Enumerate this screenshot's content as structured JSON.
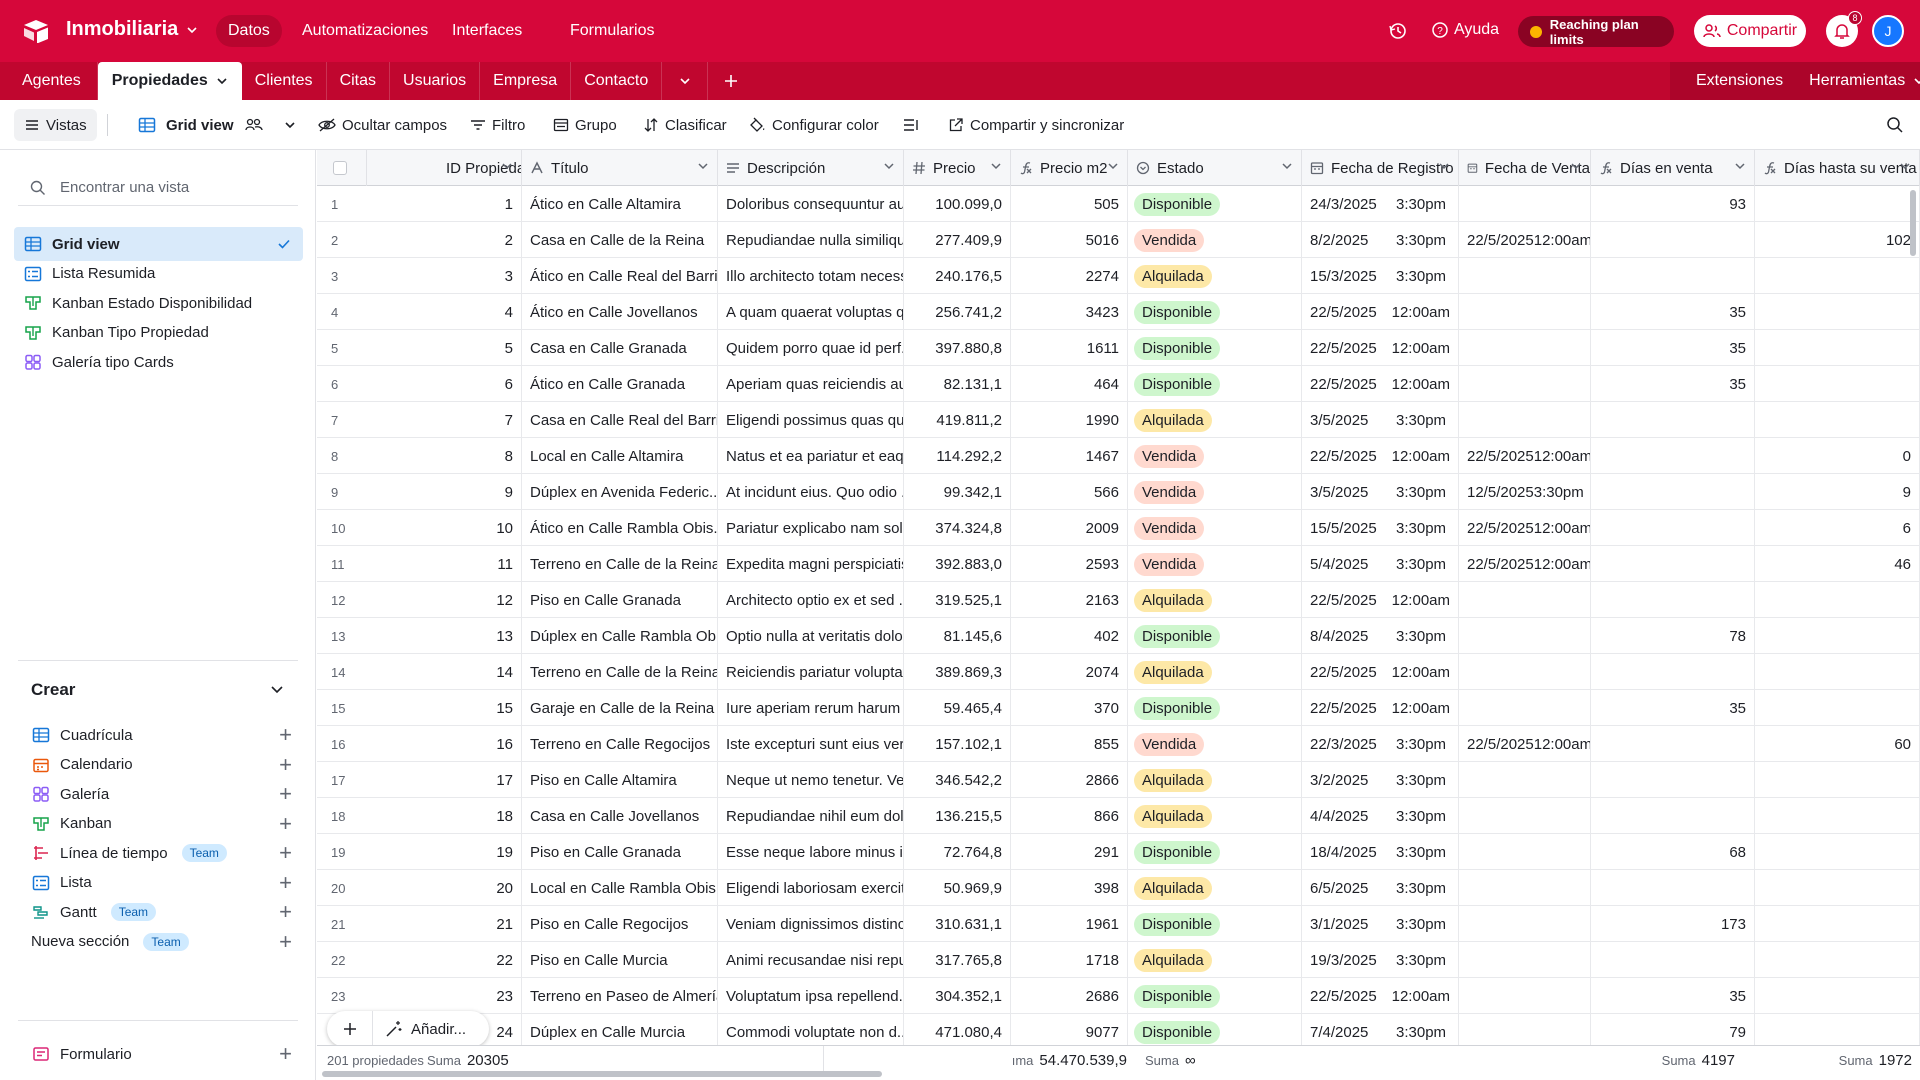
{
  "app": {
    "base_name": "Inmobiliaria",
    "nav": [
      "Datos",
      "Automatizaciones",
      "Interfaces",
      "Formularios"
    ],
    "help": "Ayuda",
    "limits": "Reaching plan limits",
    "share": "Compartir",
    "notifications": "8",
    "avatar": "J"
  },
  "tables": {
    "tabs": [
      "Agentes",
      "Propiedades",
      "Clientes",
      "Citas",
      "Usuarios",
      "Empresa",
      "Contacto"
    ],
    "active": "Propiedades",
    "extensions": "Extensiones",
    "tools": "Herramientas"
  },
  "toolbar": {
    "views": "Vistas",
    "view_name": "Grid view",
    "hide_fields": "Ocultar campos",
    "filter": "Filtro",
    "group": "Grupo",
    "sort": "Clasificar",
    "color": "Configurar color",
    "share_sync": "Compartir y sincronizar"
  },
  "sidebar": {
    "search_placeholder": "Encontrar una vista",
    "views": [
      {
        "label": "Grid view",
        "icon": "grid-icon",
        "color": "#1677d8"
      },
      {
        "label": "Lista Resumida",
        "icon": "list-icon",
        "color": "#1677d8"
      },
      {
        "label": "Kanban Estado Disponibilidad",
        "icon": "kanban-icon",
        "color": "#16a34a"
      },
      {
        "label": "Kanban Tipo Propiedad",
        "icon": "kanban-icon",
        "color": "#16a34a"
      },
      {
        "label": "Galería tipo Cards",
        "icon": "gallery-icon",
        "color": "#8b5cf6"
      }
    ],
    "create_title": "Crear",
    "create": [
      {
        "label": "Cuadrícula",
        "icon": "grid-icon",
        "color": "#1677d8",
        "team": ""
      },
      {
        "label": "Calendario",
        "icon": "calendar-icon",
        "color": "#ea580c",
        "team": ""
      },
      {
        "label": "Galería",
        "icon": "gallery-icon",
        "color": "#8b5cf6",
        "team": ""
      },
      {
        "label": "Kanban",
        "icon": "kanban-icon",
        "color": "#16a34a",
        "team": ""
      },
      {
        "label": "Línea de tiempo",
        "icon": "timeline-icon",
        "color": "#dc2650",
        "team": "Team"
      },
      {
        "label": "Lista",
        "icon": "list-icon",
        "color": "#1677d8",
        "team": ""
      },
      {
        "label": "Gantt",
        "icon": "gantt-icon",
        "color": "#0d9488",
        "team": "Team"
      },
      {
        "label": "Nueva sección",
        "icon": "",
        "color": "",
        "team": "Team"
      }
    ],
    "form": {
      "label": "Formulario",
      "icon": "form-icon",
      "color": "#db2777"
    }
  },
  "columns": [
    "ID Propiedad",
    "Título",
    "Descripción",
    "Precio",
    "Precio m2",
    "Estado",
    "Fecha de Registro",
    "Fecha de Venta",
    "Días en venta",
    "Días hasta su venta"
  ],
  "rows": [
    [
      1,
      "Ático en Calle Altamira",
      "Doloribus consequuntur au...",
      "100.099,0",
      "505",
      "Disponible",
      "24/3/2025",
      "3:30pm",
      "",
      "",
      "93",
      ""
    ],
    [
      2,
      "Casa en Calle de la Reina",
      "Repudiandae nulla similiqu...",
      "277.409,9",
      "5016",
      "Vendida",
      "8/2/2025",
      "3:30pm",
      "22/5/2025",
      "12:00am",
      "",
      "102"
    ],
    [
      3,
      "Ático en Calle Real del Barri...",
      "Illo architecto totam necess...",
      "240.176,5",
      "2274",
      "Alquilada",
      "15/3/2025",
      "3:30pm",
      "",
      "",
      "",
      ""
    ],
    [
      4,
      "Ático en Calle Jovellanos",
      "A quam quaerat voluptas q...",
      "256.741,2",
      "3423",
      "Disponible",
      "22/5/2025",
      "12:00am",
      "",
      "",
      "35",
      ""
    ],
    [
      5,
      "Casa en Calle Granada",
      "Quidem porro quae id perf...",
      "397.880,8",
      "1611",
      "Disponible",
      "22/5/2025",
      "12:00am",
      "",
      "",
      "35",
      ""
    ],
    [
      6,
      "Ático en Calle Granada",
      "Aperiam quas reiciendis au...",
      "82.131,1",
      "464",
      "Disponible",
      "22/5/2025",
      "12:00am",
      "",
      "",
      "35",
      ""
    ],
    [
      7,
      "Casa en Calle Real del Barri...",
      "Eligendi possimus quas qu...",
      "419.811,2",
      "1990",
      "Alquilada",
      "3/5/2025",
      "3:30pm",
      "",
      "",
      "",
      ""
    ],
    [
      8,
      "Local en Calle Altamira",
      "Natus et ea pariatur et eaq...",
      "114.292,2",
      "1467",
      "Vendida",
      "22/5/2025",
      "12:00am",
      "22/5/2025",
      "12:00am",
      "",
      "0"
    ],
    [
      9,
      "Dúplex en Avenida Federic...",
      "At incidunt eius. Quo odio ...",
      "99.342,1",
      "566",
      "Vendida",
      "3/5/2025",
      "3:30pm",
      "12/5/2025",
      "3:30pm",
      "",
      "9"
    ],
    [
      10,
      "Ático en Calle Rambla Obis...",
      "Pariatur explicabo nam sol...",
      "374.324,8",
      "2009",
      "Vendida",
      "15/5/2025",
      "3:30pm",
      "22/5/2025",
      "12:00am",
      "",
      "6"
    ],
    [
      11,
      "Terreno en Calle de la Reina",
      "Expedita magni perspiciatis...",
      "392.883,0",
      "2593",
      "Vendida",
      "5/4/2025",
      "3:30pm",
      "22/5/2025",
      "12:00am",
      "",
      "46"
    ],
    [
      12,
      "Piso en Calle Granada",
      "Architecto optio ex et sed ...",
      "319.525,1",
      "2163",
      "Alquilada",
      "22/5/2025",
      "12:00am",
      "",
      "",
      "",
      ""
    ],
    [
      13,
      "Dúplex en Calle Rambla Ob...",
      "Optio nulla at veritatis dolo...",
      "81.145,6",
      "402",
      "Disponible",
      "8/4/2025",
      "3:30pm",
      "",
      "",
      "78",
      ""
    ],
    [
      14,
      "Terreno en Calle de la Reina",
      "Reiciendis pariatur voluptat...",
      "389.869,3",
      "2074",
      "Alquilada",
      "22/5/2025",
      "12:00am",
      "",
      "",
      "",
      ""
    ],
    [
      15,
      "Garaje en Calle de la Reina",
      "Iure aperiam rerum harum ...",
      "59.465,4",
      "370",
      "Disponible",
      "22/5/2025",
      "12:00am",
      "",
      "",
      "35",
      ""
    ],
    [
      16,
      "Terreno en Calle Regocijos",
      "Iste excepturi sunt eius veri...",
      "157.102,1",
      "855",
      "Vendida",
      "22/3/2025",
      "3:30pm",
      "22/5/2025",
      "12:00am",
      "",
      "60"
    ],
    [
      17,
      "Piso en Calle Altamira",
      "Neque ut nemo tenetur. Ve...",
      "346.542,2",
      "2866",
      "Alquilada",
      "3/2/2025",
      "3:30pm",
      "",
      "",
      "",
      ""
    ],
    [
      18,
      "Casa en Calle Jovellanos",
      "Repudiandae nihil eum dol...",
      "136.215,5",
      "866",
      "Alquilada",
      "4/4/2025",
      "3:30pm",
      "",
      "",
      "",
      ""
    ],
    [
      19,
      "Piso en Calle Granada",
      "Esse neque labore minus in...",
      "72.764,8",
      "291",
      "Disponible",
      "18/4/2025",
      "3:30pm",
      "",
      "",
      "68",
      ""
    ],
    [
      20,
      "Local en Calle Rambla Obis...",
      "Eligendi laboriosam exercit...",
      "50.969,9",
      "398",
      "Alquilada",
      "6/5/2025",
      "3:30pm",
      "",
      "",
      "",
      ""
    ],
    [
      21,
      "Piso en Calle Regocijos",
      "Veniam dignissimos distinc...",
      "310.631,1",
      "1961",
      "Disponible",
      "3/1/2025",
      "3:30pm",
      "",
      "",
      "173",
      ""
    ],
    [
      22,
      "Piso en Calle Murcia",
      "Animi recusandae nisi repu...",
      "317.765,8",
      "1718",
      "Alquilada",
      "19/3/2025",
      "3:30pm",
      "",
      "",
      "",
      ""
    ],
    [
      23,
      "Terreno en Paseo de Almería",
      "Voluptatum ipsa repellend...",
      "304.352,1",
      "2686",
      "Disponible",
      "22/5/2025",
      "12:00am",
      "",
      "",
      "35",
      ""
    ],
    [
      24,
      "Dúplex en Calle Murcia",
      "Commodi voluptate non d...",
      "471.080,4",
      "9077",
      "Disponible",
      "7/4/2025",
      "3:30pm",
      "",
      "",
      "79",
      ""
    ]
  ],
  "footer": {
    "count": "201 propiedades",
    "sum_label": "Suma",
    "id_sum": "20305",
    "price_label": "ıma",
    "price_sum": "54.470.539,9",
    "m2_sum": "∞",
    "days_sum": "4197",
    "until_sum": "1972"
  },
  "add": {
    "ai": "Añadir..."
  }
}
